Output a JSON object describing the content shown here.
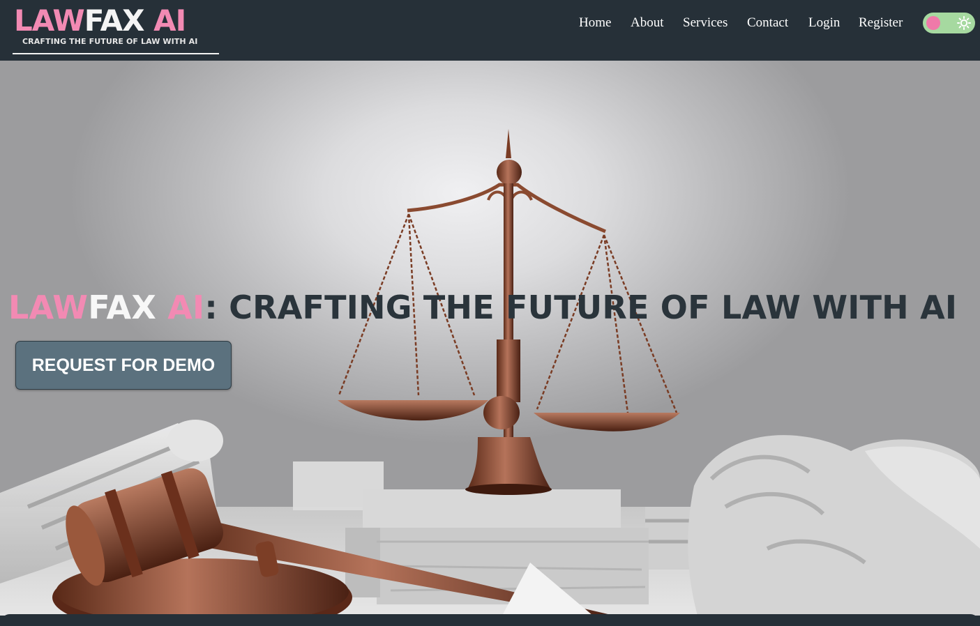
{
  "brand": {
    "name_part1": "LAW",
    "name_part2": "FAX",
    "name_part3": "AI",
    "tagline": "CRAFTING THE FUTURE OF LAW WITH AI"
  },
  "nav": {
    "items": [
      {
        "label": "Home"
      },
      {
        "label": "About"
      },
      {
        "label": "Services"
      },
      {
        "label": "Contact"
      },
      {
        "label": "Login"
      },
      {
        "label": "Register"
      }
    ]
  },
  "theme_toggle": {
    "icon": "sun-icon",
    "colors": {
      "track": "#a6d9a0",
      "knob": "#ef7aa9"
    }
  },
  "hero": {
    "heading_part1": "LAW",
    "heading_part2": "FAX",
    "heading_part3": " AI",
    "heading_rest": ": CRAFTING THE FUTURE OF LAW WITH AI",
    "cta_label": "REQUEST FOR DEMO",
    "background_image": "scales-of-justice-gavel-photo"
  },
  "colors": {
    "header_bg": "#263038",
    "brand_pink": "#f28ab3",
    "cta_bg": "#5b717e",
    "heading_dark": "#2a343b"
  }
}
